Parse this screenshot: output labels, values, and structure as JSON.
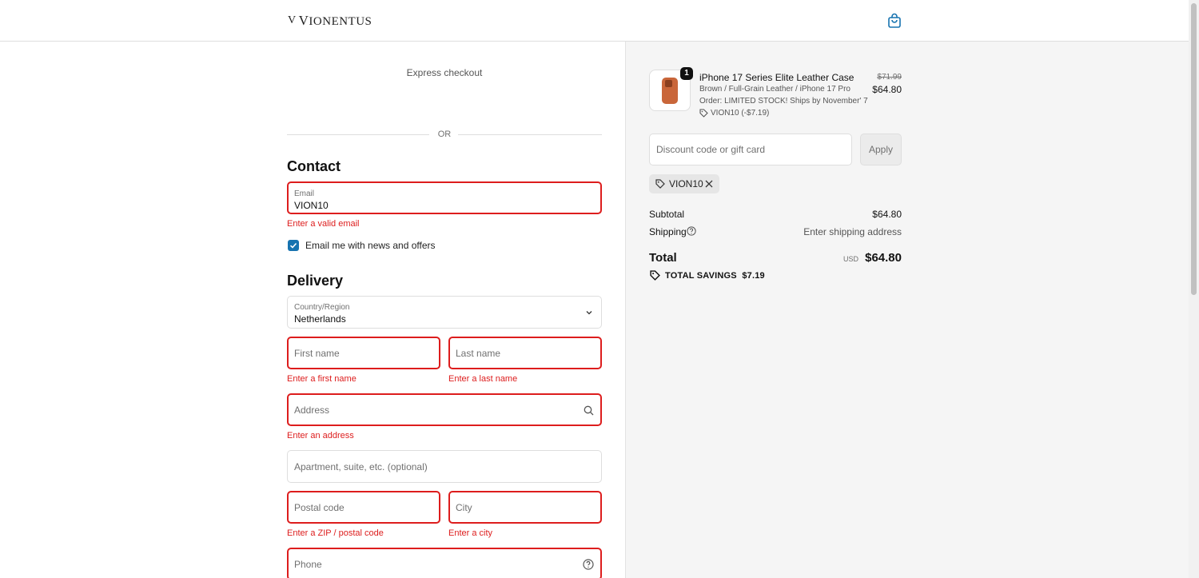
{
  "header": {
    "logo_mark": "V",
    "logo_first": "V",
    "logo_rest": "IONENTUS",
    "cart_icon": "shopping-bag-icon"
  },
  "express": {
    "label": "Express checkout",
    "or": "OR"
  },
  "contact": {
    "heading": "Contact",
    "email_label": "Email",
    "email_value": "VION10",
    "email_error": "Enter a valid email",
    "newsletter_label": "Email me with news and offers",
    "newsletter_checked": true
  },
  "delivery": {
    "heading": "Delivery",
    "country_label": "Country/Region",
    "country_value": "Netherlands",
    "first_name_placeholder": "First name",
    "first_name_error": "Enter a first name",
    "last_name_placeholder": "Last name",
    "last_name_error": "Enter a last name",
    "address_placeholder": "Address",
    "address_error": "Enter an address",
    "apartment_placeholder": "Apartment, suite, etc. (optional)",
    "postal_placeholder": "Postal code",
    "postal_error": "Enter a ZIP / postal code",
    "city_placeholder": "City",
    "city_error": "Enter a city",
    "phone_placeholder": "Phone"
  },
  "summary": {
    "product": {
      "quantity": "1",
      "title": "iPhone 17 Series Elite Leather Case",
      "variant": "Brown / Full-Grain Leather / iPhone 17 Pro",
      "order_note": "Order: LIMITED STOCK! Ships by November' 7",
      "discount_line": "VION10 (-$7.19)",
      "original_price": "$71.99",
      "price": "$64.80"
    },
    "discount_placeholder": "Discount code or gift card",
    "apply_label": "Apply",
    "applied_code": "VION10",
    "subtotal_label": "Subtotal",
    "subtotal_value": "$64.80",
    "shipping_label": "Shipping",
    "shipping_value": "Enter shipping address",
    "total_label": "Total",
    "currency": "USD",
    "total_value": "$64.80",
    "savings_label": "TOTAL SAVINGS",
    "savings_value": "$7.19"
  },
  "colors": {
    "accent": "#1773b0",
    "error": "#dd1d1d",
    "summary_bg": "#f5f5f5"
  }
}
